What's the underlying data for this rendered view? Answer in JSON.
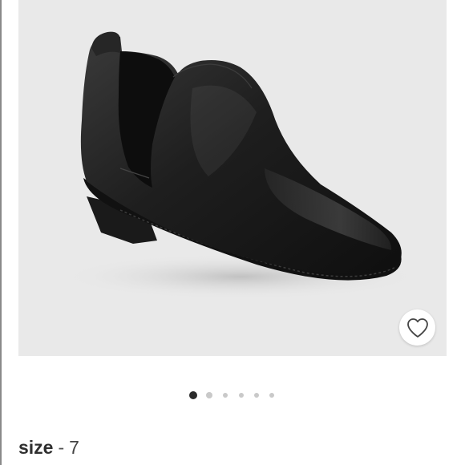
{
  "product": {
    "image": {
      "subject": "black-leather-ankle-bootie",
      "background_color": "#e9e9e9"
    },
    "favorite": {
      "icon": "heart-outline-icon",
      "color": "#444444"
    },
    "carousel": {
      "total": 6,
      "active_index": 0,
      "active_color": "#2b2b2b",
      "inactive_color": "#c9c9c9"
    },
    "size": {
      "label": "size",
      "separator": "-",
      "value": "7"
    }
  }
}
